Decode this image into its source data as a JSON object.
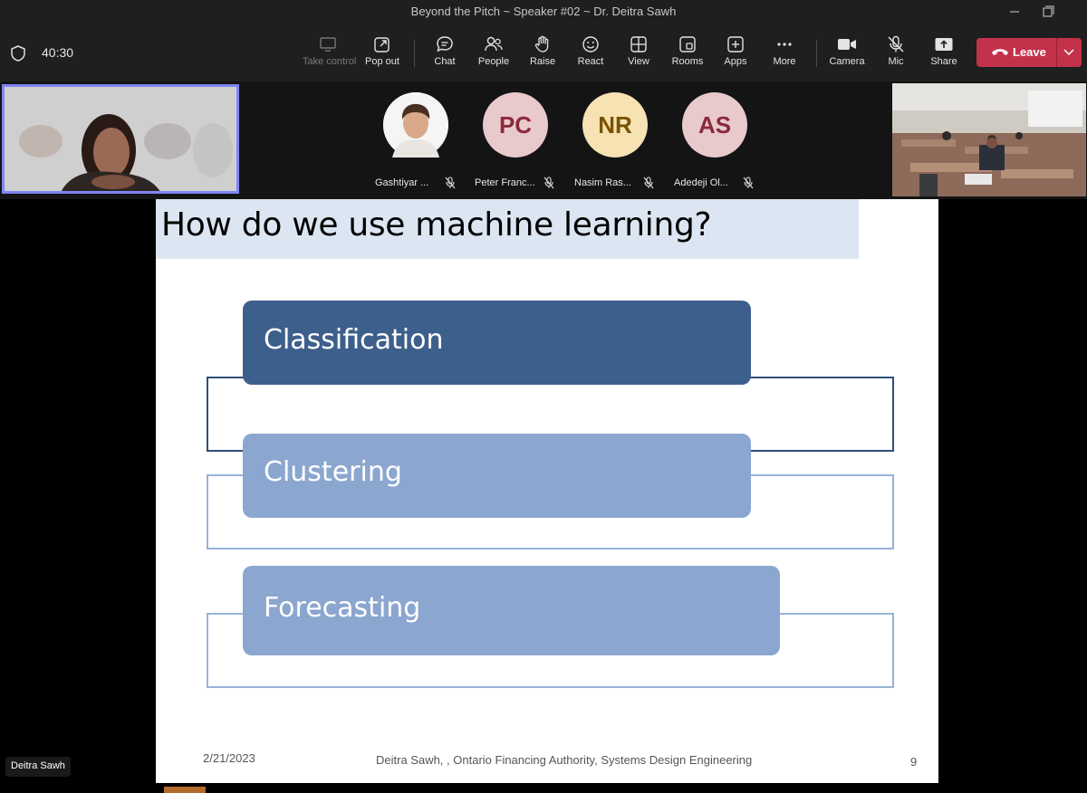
{
  "window": {
    "title": "Beyond the Pitch ~ Speaker #02 ~ Dr. Deitra Sawh"
  },
  "meeting": {
    "timer": "40:30"
  },
  "toolbar": {
    "take_control": "Take control",
    "pop_out": "Pop out",
    "chat": "Chat",
    "people": "People",
    "raise": "Raise",
    "react": "React",
    "view": "View",
    "rooms": "Rooms",
    "apps": "Apps",
    "more": "More",
    "camera": "Camera",
    "mic": "Mic",
    "share": "Share",
    "leave": "Leave"
  },
  "participants": [
    {
      "name": "Gashtiyar ...",
      "initials": "",
      "avatar_color": "#ffffff"
    },
    {
      "name": "Peter Franc...",
      "initials": "PC",
      "avatar_color": "#e8c9cc",
      "text_color": "#8a2a3a"
    },
    {
      "name": "Nasim Ras...",
      "initials": "NR",
      "avatar_color": "#f6e2b3",
      "text_color": "#7a5200"
    },
    {
      "name": "Adedeji Ol...",
      "initials": "AS",
      "avatar_color": "#e8c9cc",
      "text_color": "#8a2a3a"
    }
  ],
  "slide": {
    "title": "How do we use machine learning?",
    "items": [
      {
        "label": "Classification",
        "color": "#3d5f8c"
      },
      {
        "label": "Clustering",
        "color": "#8ba6cf"
      },
      {
        "label": "Forecasting",
        "color": "#8ba6cf"
      }
    ],
    "date": "2/21/2023",
    "footer": "Deitra Sawh, , Ontario Financing Authority, Systems Design Engineering",
    "page_number": "9"
  },
  "presenter": {
    "name": "Deitra Sawh"
  }
}
